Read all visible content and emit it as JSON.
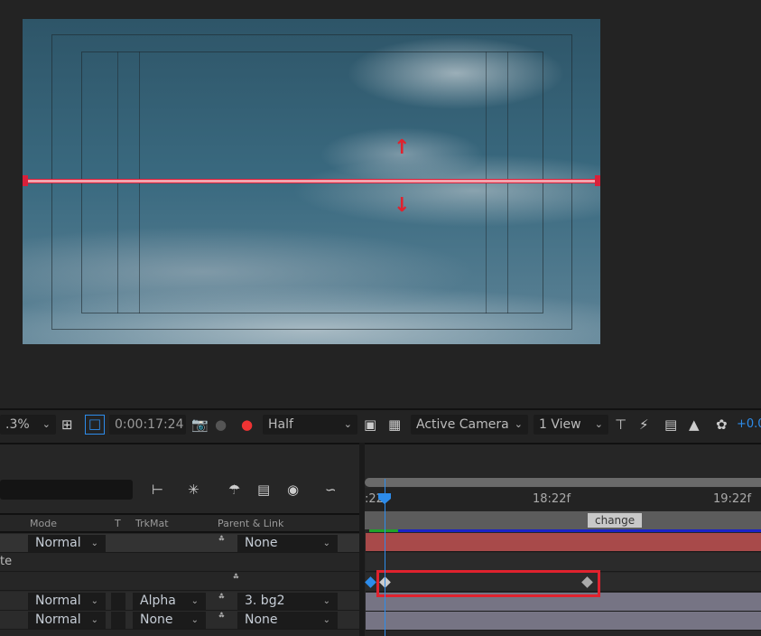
{
  "viewer": {
    "selection_color": "#d8203a"
  },
  "toolbar": {
    "zoom": ".3%",
    "timecode": "0:00:17:24",
    "resolution": "Half",
    "camera": "Active Camera",
    "views": "1 View",
    "exposure": "+0.0",
    "icons": [
      "region-of-interest-icon",
      "transparency-grid-icon",
      "snapshot-icon",
      "show-snapshot-icon",
      "channel-icon",
      "fast-preview-icon",
      "timeline-icon",
      "flowchart-icon",
      "reset-exposure-icon"
    ]
  },
  "timeline": {
    "columns": {
      "mode": "Mode",
      "t": "T",
      "trkmat": "TrkMat",
      "parent": "Parent & Link"
    },
    "ruler": {
      "start": ":22f",
      "mid": "18:22f",
      "end": "19:22f"
    },
    "marker": "change",
    "rows": [
      {
        "mode": "Normal",
        "trkmat": "",
        "parent": "None"
      },
      {
        "label": "te"
      },
      {
        "spiral": true
      },
      {
        "mode": "Normal",
        "trkmat": "Alpha",
        "parent": "3. bg2"
      },
      {
        "mode": "Normal",
        "trkmat": "None",
        "parent": "None"
      }
    ],
    "accent": "#2d8ceb",
    "highlight": "#e0222e"
  }
}
